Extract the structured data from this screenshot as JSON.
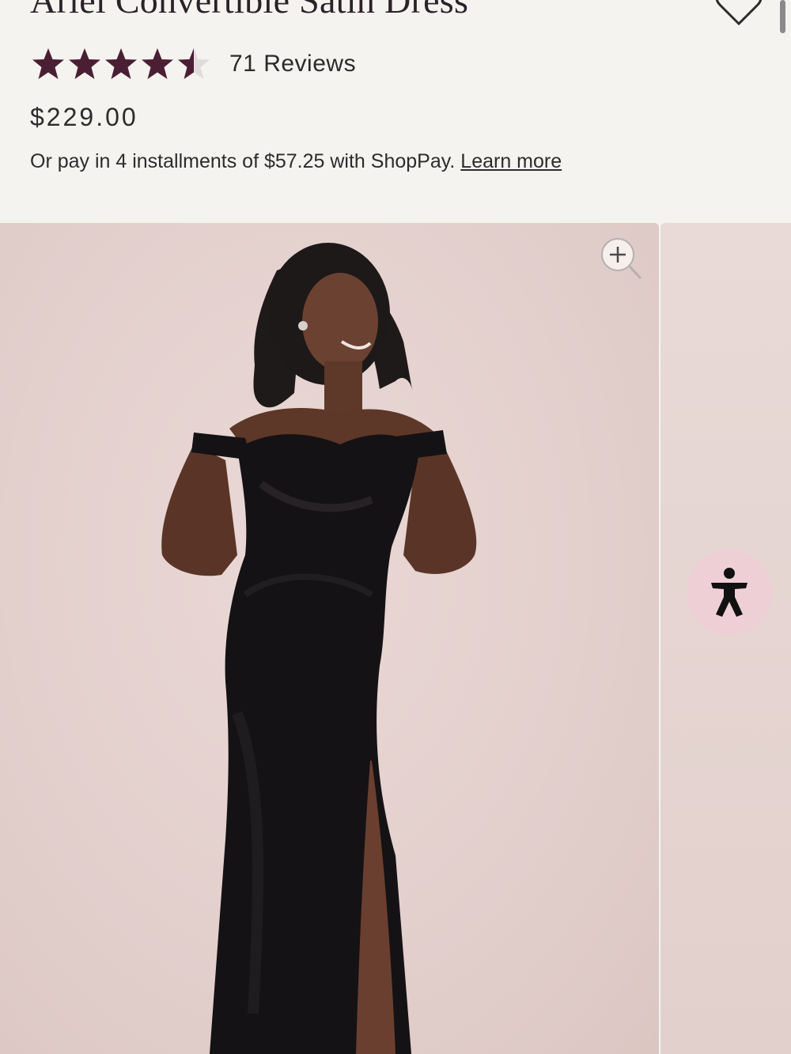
{
  "product": {
    "title": "Ariel Convertible Satin Dress",
    "rating": 4.5,
    "rating_max": 5,
    "reviews_label": "71 Reviews",
    "price": "$229.00",
    "installments_text": "Or pay in 4 installments of $57.25 with ShopPay.",
    "learn_more_label": "Learn more"
  },
  "gallery": {
    "zoom_icon": "zoom-in-icon",
    "accessibility_icon": "accessibility-icon"
  },
  "colors": {
    "star": "#4a1f33",
    "star_empty": "#e0dcdc",
    "accessibility_bg": "#efcfd6",
    "background": "#f4f3f0"
  }
}
